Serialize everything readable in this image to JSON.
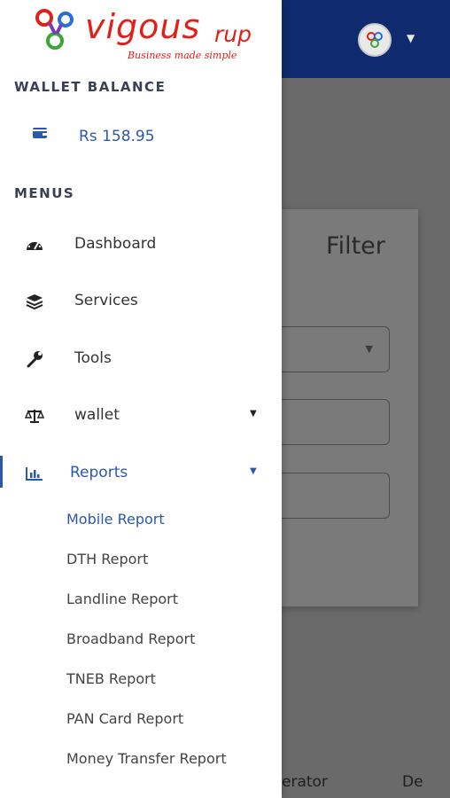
{
  "brand": {
    "name": "vigous",
    "suffix": "rup",
    "tagline": "Business made simple",
    "color": "#e0201b"
  },
  "wallet": {
    "heading": "WALLET BALANCE",
    "balance": "Rs 158.95"
  },
  "menus": {
    "heading": "MENUS",
    "items": [
      {
        "label": "Dashboard",
        "icon": "dashboard-icon"
      },
      {
        "label": "Services",
        "icon": "layers-icon"
      },
      {
        "label": "Tools",
        "icon": "wrench-icon"
      },
      {
        "label": "wallet",
        "icon": "balance-scale-icon",
        "expandable": true
      },
      {
        "label": "Reports",
        "icon": "bar-chart-icon",
        "expandable": true,
        "active": true
      }
    ],
    "reports_submenu": [
      "Mobile Report",
      "DTH Report",
      "Landline Report",
      "Broadband Report",
      "TNEB Report",
      "PAN Card Report",
      "Money Transfer Report"
    ]
  },
  "background": {
    "filter_title": "Filter",
    "table_headers": [
      "erator",
      "De"
    ]
  },
  "colors": {
    "header": "#0f2a6e",
    "accent": "#2c58a8",
    "drawer": "#ffffff",
    "overlay": "#6a6a6a"
  }
}
